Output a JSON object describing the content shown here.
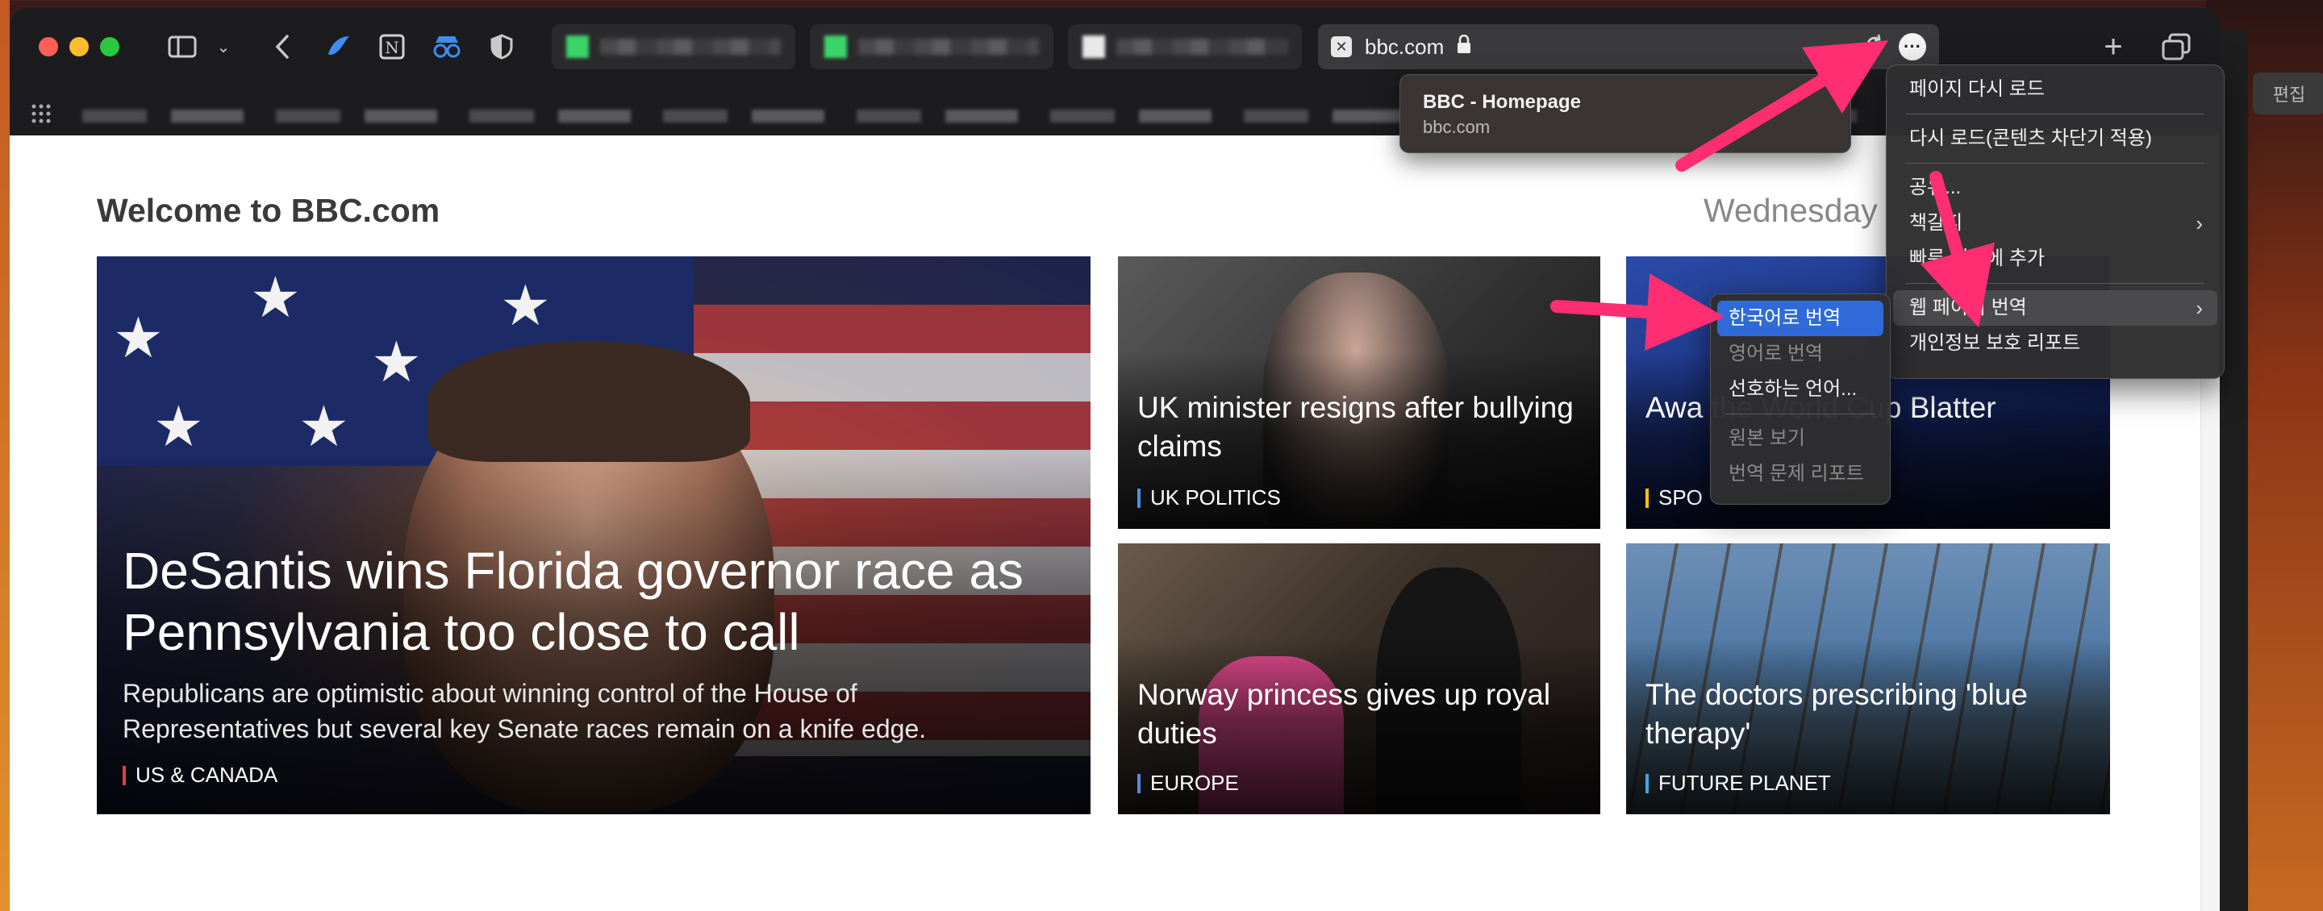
{
  "browser": {
    "address_bar": {
      "url": "bbc.com"
    },
    "tooltip": {
      "title": "BBC - Homepage",
      "subtitle": "bbc.com"
    },
    "right_edge_button": "편집"
  },
  "page": {
    "welcome_title": "Welcome to BBC.com",
    "date_text": "Wednesday",
    "cards": {
      "main": {
        "headline": "DeSantis wins Florida governor race as Pennsylvania too close to call",
        "summary": "Republicans are optimistic about winning control of the House of Representatives but several key Senate races remain on a knife edge.",
        "tag": "US & CANADA"
      },
      "uk": {
        "headline": "UK minister resigns after bullying claims",
        "tag": "UK POLITICS"
      },
      "sport": {
        "headline": "Awa                  the World Cup                   Blatter",
        "tag": "SPO"
      },
      "norway": {
        "headline": "Norway princess gives up royal duties",
        "tag": "EUROPE"
      },
      "doctors": {
        "headline": "The doctors prescribing 'blue therapy'",
        "tag": "FUTURE PLANET"
      }
    }
  },
  "page_menu": {
    "items": [
      {
        "label": "페이지 다시 로드"
      },
      {
        "label": "다시 로드(콘텐츠 차단기 적용)"
      },
      {
        "label": "공유..."
      },
      {
        "label": "책갈피"
      },
      {
        "label": "빠른 메모에 추가"
      },
      {
        "label": "웹 페이지 번역"
      },
      {
        "label": "개인정보 보호 리포트"
      }
    ]
  },
  "translate_submenu": {
    "items": [
      {
        "label": "한국어로 번역",
        "state": "selected"
      },
      {
        "label": "영어로 번역",
        "state": "disabled"
      },
      {
        "label": "선호하는 언어...",
        "state": "enabled"
      },
      {
        "label": "원본 보기",
        "state": "disabled"
      },
      {
        "label": "번역 문제 리포트",
        "state": "disabled"
      }
    ]
  },
  "colors": {
    "accent_arrow": "#ff2e72",
    "selection_blue": "#2f6ad8"
  },
  "icons": [
    "sidebar-icon",
    "chevron-down-icon",
    "back-icon",
    "lock-icon",
    "reload-icon",
    "more-icon",
    "plus-icon",
    "tabs-overview-icon",
    "grid-icon"
  ]
}
